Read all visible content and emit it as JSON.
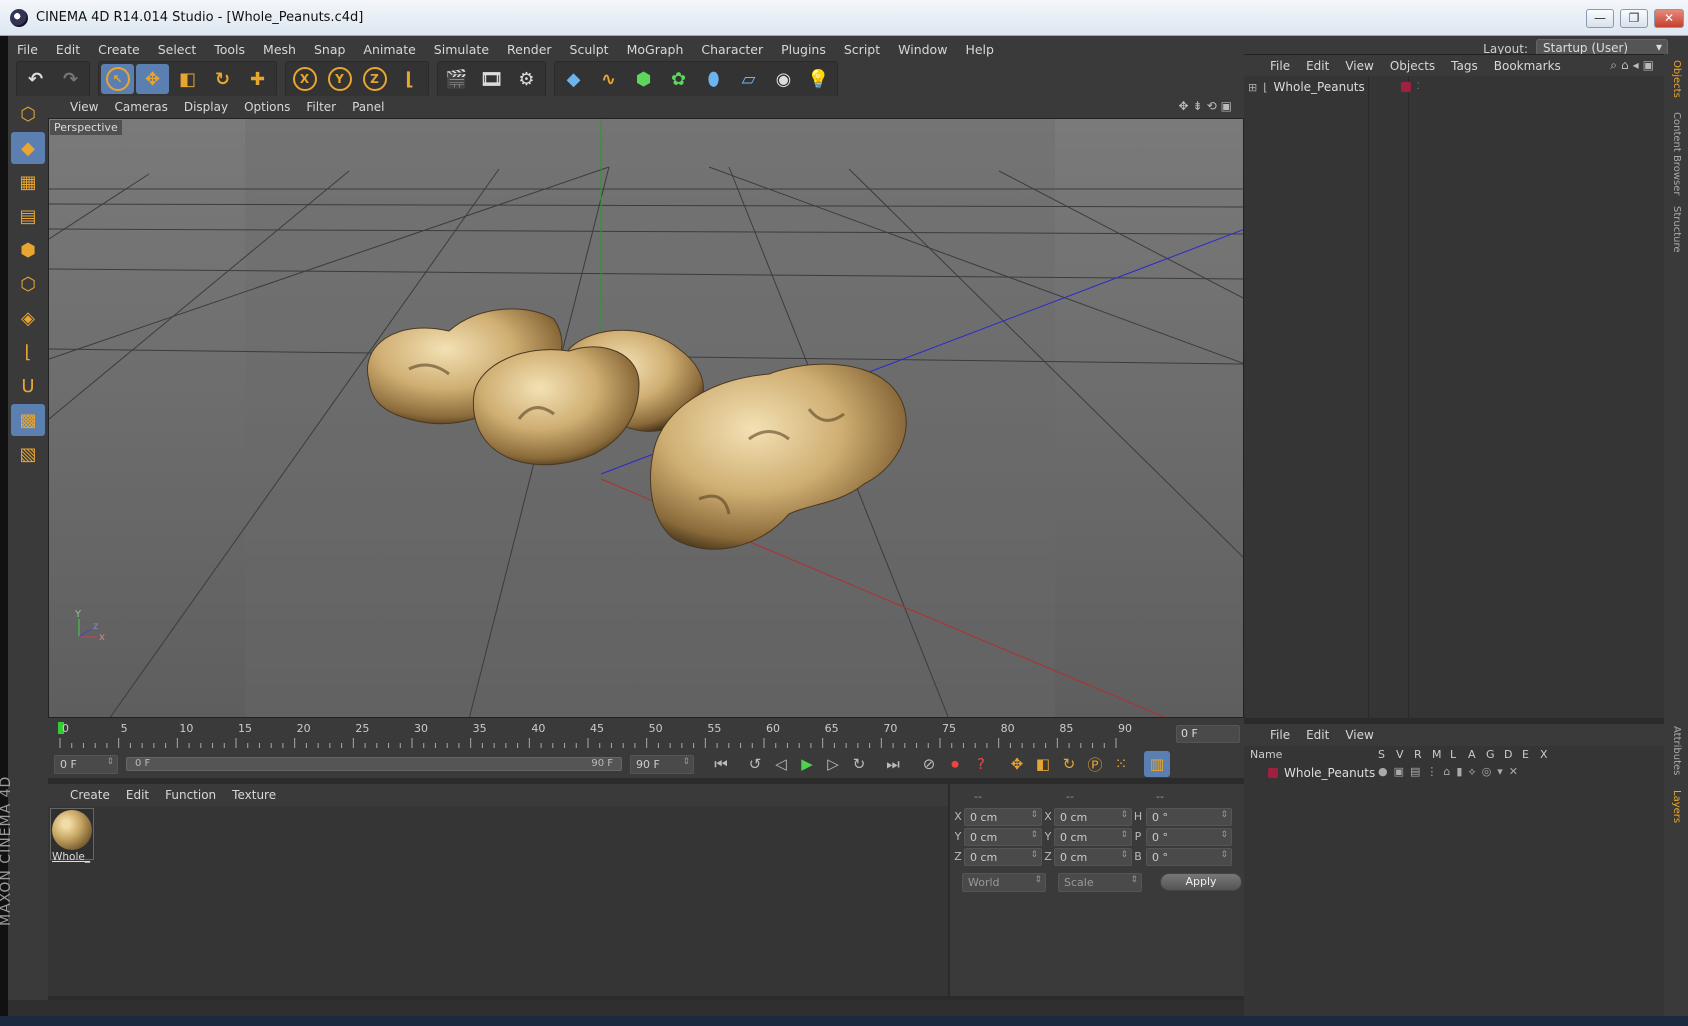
{
  "window": {
    "title": "CINEMA 4D R14.014 Studio - [Whole_Peanuts.c4d]",
    "min": "—",
    "max": "❐",
    "close": "✕"
  },
  "menubar": {
    "items": [
      "File",
      "Edit",
      "Create",
      "Select",
      "Tools",
      "Mesh",
      "Snap",
      "Animate",
      "Simulate",
      "Render",
      "Sculpt",
      "MoGraph",
      "Character",
      "Plugins",
      "Script",
      "Window",
      "Help"
    ],
    "layout_label": "Layout:",
    "layout_value": "Startup (User)"
  },
  "viewport": {
    "menu": [
      "View",
      "Cameras",
      "Display",
      "Options",
      "Filter",
      "Panel"
    ],
    "label": "Perspective",
    "axis": {
      "x": "x",
      "y": "Y",
      "z": "z"
    }
  },
  "timeline": {
    "ticks": [
      "0",
      "5",
      "10",
      "15",
      "20",
      "25",
      "30",
      "35",
      "40",
      "45",
      "50",
      "55",
      "60",
      "65",
      "70",
      "75",
      "80",
      "85",
      "90"
    ],
    "current_frame": "0 F",
    "start_field": "0 F",
    "range_start": "0 F",
    "range_end": "90 F",
    "end_field": "90 F"
  },
  "material_manager": {
    "menu": [
      "Create",
      "Edit",
      "Function",
      "Texture"
    ],
    "materials": [
      {
        "name": "Whole_"
      }
    ]
  },
  "coordinates": {
    "headers": [
      "--",
      "--",
      "--"
    ],
    "rows": [
      {
        "l1": "X",
        "v1": "0 cm",
        "l2": "X",
        "v2": "0 cm",
        "l3": "H",
        "v3": "0 °"
      },
      {
        "l1": "Y",
        "v1": "0 cm",
        "l2": "Y",
        "v2": "0 cm",
        "l3": "P",
        "v3": "0 °"
      },
      {
        "l1": "Z",
        "v1": "0 cm",
        "l2": "Z",
        "v2": "0 cm",
        "l3": "B",
        "v3": "0 °"
      }
    ],
    "mode1": "World",
    "mode2": "Scale",
    "apply": "Apply"
  },
  "object_manager": {
    "menu": [
      "File",
      "Edit",
      "View",
      "Objects",
      "Tags",
      "Bookmarks"
    ],
    "objects": [
      {
        "name": "Whole_Peanuts",
        "tag_color": "#a02040"
      }
    ]
  },
  "layer_manager": {
    "menu": [
      "File",
      "Edit",
      "View"
    ],
    "columns": [
      "Name",
      "S",
      "V",
      "R",
      "M",
      "L",
      "A",
      "G",
      "D",
      "E",
      "X"
    ],
    "layers": [
      {
        "name": "Whole_Peanuts",
        "color": "#a02040"
      }
    ]
  },
  "side_tabs": [
    "Objects",
    "Content Browser",
    "Structure",
    "Attributes",
    "Layers"
  ],
  "branding": "MAXON CINEMA 4D",
  "colors": {
    "accent": "#e8a530",
    "active": "#5b7fb0",
    "bg": "#3a3a3a"
  }
}
